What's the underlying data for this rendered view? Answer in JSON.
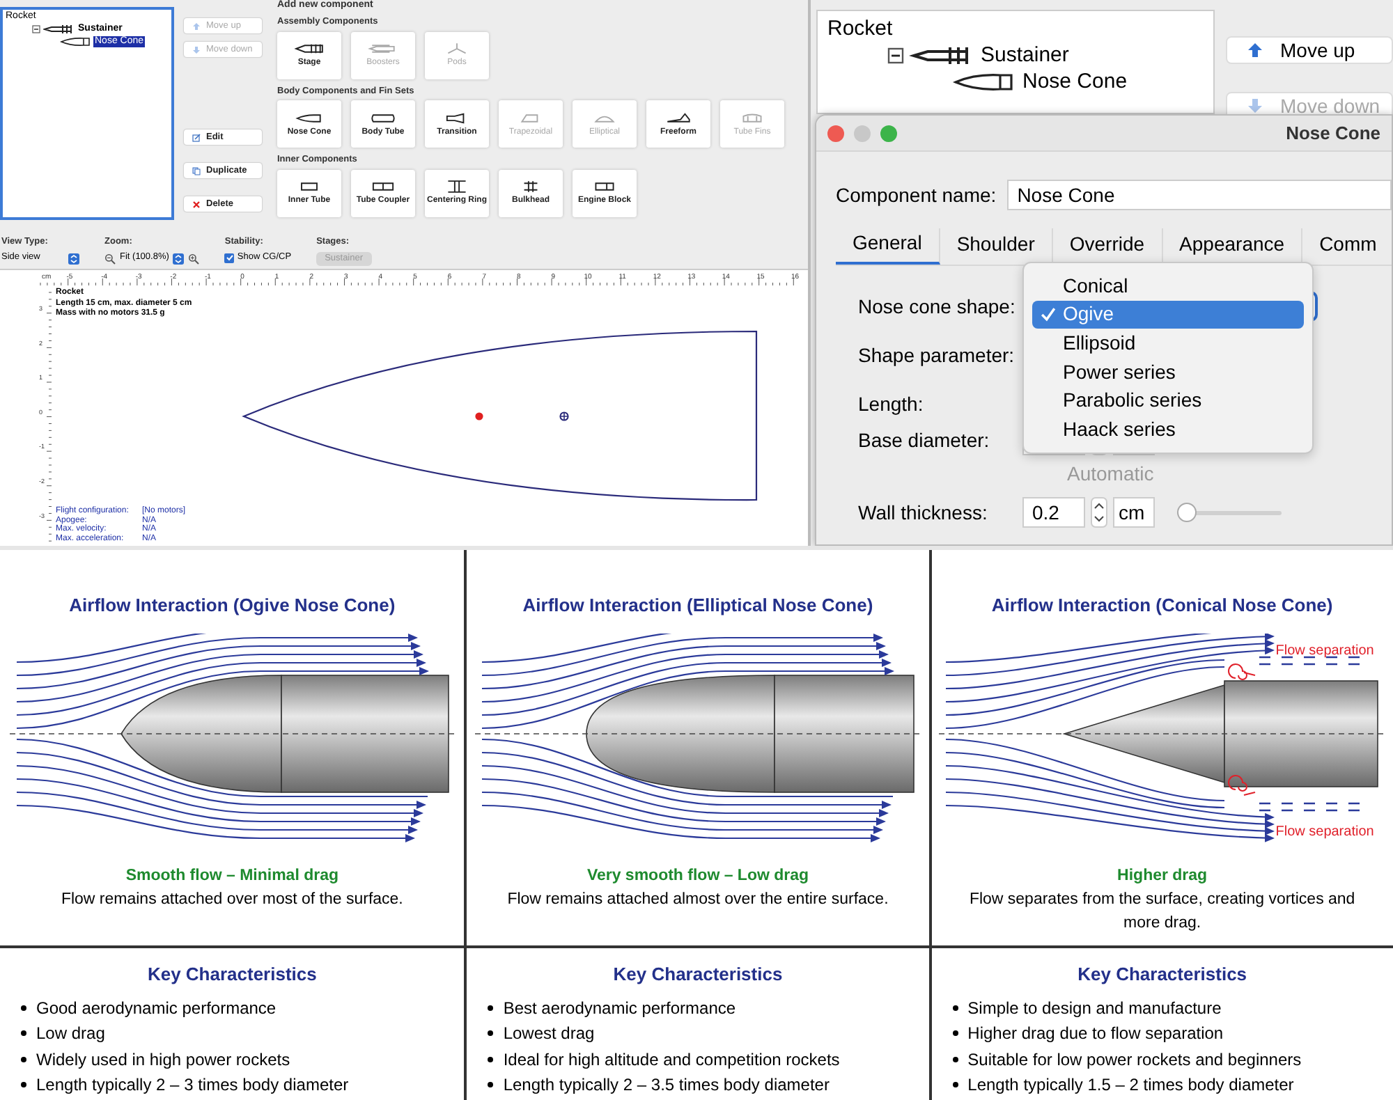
{
  "openrocket": {
    "tree": {
      "label": "Rocket",
      "children": [
        {
          "label": "Sustainer",
          "kind": "stage",
          "expanded": true,
          "children": [
            {
              "label": "Nose Cone",
              "kind": "nose_cone",
              "selected": true
            }
          ]
        }
      ]
    },
    "actions": [
      {
        "label": "Move up",
        "kind": "up",
        "disabled": true
      },
      {
        "label": "Move down",
        "kind": "down",
        "disabled": true
      },
      {
        "label": "Edit",
        "kind": "edit",
        "disabled": false
      },
      {
        "label": "Duplicate",
        "kind": "duplicate",
        "disabled": false
      },
      {
        "label": "Delete",
        "kind": "delete",
        "disabled": false
      }
    ],
    "palette": {
      "title": "Add new component",
      "sections": [
        {
          "title": "Assembly Components",
          "items": [
            {
              "label": "Stage",
              "disabled": false
            },
            {
              "label": "Boosters",
              "disabled": true
            },
            {
              "label": "Pods",
              "disabled": true
            }
          ]
        },
        {
          "title": "Body Components and Fin Sets",
          "items": [
            {
              "label": "Nose Cone",
              "disabled": false
            },
            {
              "label": "Body Tube",
              "disabled": false
            },
            {
              "label": "Transition",
              "disabled": false
            },
            {
              "label": "Trapezoidal",
              "disabled": true
            },
            {
              "label": "Elliptical",
              "disabled": true
            },
            {
              "label": "Freeform",
              "disabled": false
            },
            {
              "label": "Tube Fins",
              "disabled": true
            }
          ]
        },
        {
          "title": "Inner Components",
          "items": [
            {
              "label": "Inner Tube",
              "disabled": false
            },
            {
              "label": "Tube Coupler",
              "disabled": false
            },
            {
              "label": "Centering Ring",
              "disabled": false
            },
            {
              "label": "Bulkhead",
              "disabled": false
            },
            {
              "label": "Engine Block",
              "disabled": false
            }
          ]
        }
      ]
    },
    "toolbar": {
      "view_type": {
        "label": "View Type:",
        "value": "Side view"
      },
      "zoom": {
        "label": "Zoom:",
        "value": "Fit (100.8%)"
      },
      "stability": {
        "label": "Stability:",
        "checkbox": "Show CG/CP",
        "checked": true
      },
      "stages": {
        "label": "Stages:",
        "value": "Sustainer"
      }
    },
    "ruler_unit": "cm",
    "ruler_labels": [
      "-5",
      "-4",
      "-3",
      "-2",
      "-1",
      "0",
      "1",
      "2",
      "3",
      "4",
      "5",
      "6",
      "7",
      "8",
      "9",
      "10",
      "11",
      "12",
      "13",
      "14",
      "15",
      "16"
    ],
    "vertical_ruler_labels": [
      "3",
      "2",
      "1",
      "0",
      "-1",
      "-2",
      "-3"
    ],
    "figure_info": [
      "Rocket",
      "Length 15 cm, max. diameter 5 cm",
      "Mass with no motors 31.5 g"
    ],
    "flight_info": [
      {
        "label": "Flight configuration:",
        "value": "[No motors]"
      },
      {
        "label": "Apogee:",
        "value": "N/A"
      },
      {
        "label": "Max. velocity:",
        "value": "N/A"
      },
      {
        "label": "Max. acceleration:",
        "value": "N/A"
      }
    ]
  },
  "editor": {
    "tree": {
      "label": "Rocket",
      "children": [
        {
          "label": "Sustainer",
          "kind": "stage",
          "expanded": true,
          "children": [
            {
              "label": "Nose Cone",
              "kind": "nose_cone",
              "selected": false
            }
          ]
        }
      ]
    },
    "actions": [
      {
        "label": "Move up",
        "kind": "up",
        "disabled": false
      },
      {
        "label": "Move down",
        "kind": "down",
        "disabled": true
      }
    ],
    "dialog": {
      "title": "Nose Cone",
      "name_label": "Component name:",
      "name_value": "Nose Cone",
      "tabs": [
        {
          "label": "General",
          "selected": true
        },
        {
          "label": "Shoulder",
          "selected": false
        },
        {
          "label": "Override",
          "selected": false
        },
        {
          "label": "Appearance",
          "selected": false
        },
        {
          "label": "Comm",
          "selected": false
        }
      ],
      "rows": [
        {
          "label": "Nose cone shape:",
          "kind": "select"
        },
        {
          "label": "Shape parameter:",
          "kind": "blank"
        },
        {
          "label": "Length:",
          "kind": "blank"
        },
        {
          "label": "Base diameter:",
          "kind": "number"
        },
        {
          "label": "Automatic",
          "kind": "note",
          "disabled": true
        },
        {
          "label": "Wall thickness:",
          "kind": "number",
          "value": "0.2",
          "unit": "cm",
          "level": 0
        }
      ],
      "shape_options": [
        {
          "label": "Conical",
          "selected": false
        },
        {
          "label": "Ogive",
          "selected": true
        },
        {
          "label": "Ellipsoid",
          "selected": false
        },
        {
          "label": "Power series",
          "selected": false
        },
        {
          "label": "Parabolic series",
          "selected": false
        },
        {
          "label": "Haack series",
          "selected": false
        }
      ]
    }
  },
  "airflow_panels": [
    {
      "kind": "ogive",
      "title": "Airflow Interaction (Ogive Nose Cone)",
      "caption": "Smooth flow – Minimal drag",
      "description": "Flow remains attached over most of the surface."
    },
    {
      "kind": "elliptical",
      "title": "Airflow Interaction (Elliptical Nose Cone)",
      "caption": "Very smooth flow – Low drag",
      "description": "Flow remains attached almost over the entire surface."
    },
    {
      "kind": "conical",
      "title": "Airflow Interaction (Conical Nose Cone)",
      "caption": "Higher drag",
      "description": "Flow separates from the surface, creating vortices and more drag.",
      "separation_labels": [
        "Flow separation",
        "Flow separation"
      ]
    }
  ],
  "key_characteristics": [
    {
      "title": "Key Characteristics",
      "bullets": [
        "Good aerodynamic performance",
        "Low drag",
        "Widely used in high power rockets",
        "Length typically 2 – 3 times body diameter"
      ]
    },
    {
      "title": "Key Characteristics",
      "bullets": [
        "Best aerodynamic performance",
        "Lowest drag",
        "Ideal for high altitude and competition rockets",
        "Length typically 2 – 3.5 times body diameter"
      ]
    },
    {
      "title": "Key Characteristics",
      "bullets": [
        "Simple to design and manufacture",
        "Higher drag due to flow separation",
        "Suitable for low power rockets and beginners",
        "Length typically 1.5 – 2 times body diameter"
      ]
    }
  ]
}
